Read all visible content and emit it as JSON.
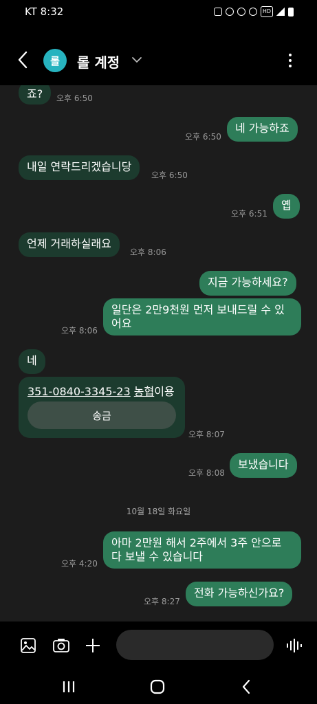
{
  "status": {
    "carrier_time": "KT 8:32",
    "hd_label": "HD"
  },
  "header": {
    "avatar_initial": "롤",
    "title": "롤 계정"
  },
  "messages": [
    {
      "dir": "in",
      "text": "죠?",
      "time": "오후 6:50"
    },
    {
      "dir": "out",
      "text": "네 가능하죠",
      "time": "오후 6:50"
    },
    {
      "dir": "in",
      "text": "내일 연락드리겠습니당",
      "time": "오후 6:50"
    },
    {
      "dir": "out",
      "text": "옙",
      "time": "오후 6:51"
    },
    {
      "dir": "in",
      "text": "언제 거래하실래요",
      "time": "오후 8:06"
    },
    {
      "dir": "out",
      "text": "지금 가능하세요?",
      "time": ""
    },
    {
      "dir": "out",
      "text": "일단은 2만9천원 먼저 보내드릴 수 있어요",
      "time": "오후 8:06"
    },
    {
      "dir": "in",
      "text": "네",
      "time": ""
    },
    {
      "dir": "out",
      "text": "보냈습니다",
      "time": "오후 8:08"
    },
    {
      "dir": "out",
      "text": "아마 2만원 해서 2주에서 3주 안으로 다 보낼 수 있습니다",
      "time": "오후 4:20"
    },
    {
      "dir": "out",
      "text": "전화 가능하신가요?",
      "time": "오후 8:27"
    }
  ],
  "account_card": {
    "account_number": "351-0840-3345-23",
    "bank_text": "농협",
    "suffix": "이용",
    "send_label": "송금",
    "time": "오후 8:07"
  },
  "date_separator": "10월 18일 화요일",
  "composer": {
    "input_value": ""
  },
  "icons": [
    "back-icon",
    "chevron-down-icon",
    "more-icon",
    "gallery-icon",
    "camera-icon",
    "plus-icon",
    "emoji-icon",
    "voice-icon",
    "recent-apps-icon",
    "home-icon",
    "nav-back-icon"
  ],
  "colors": {
    "incoming": "#1c3b2e",
    "outgoing": "#2e7d59",
    "avatar": "#27b3bf",
    "chat_bg": "#1c1c1c"
  }
}
